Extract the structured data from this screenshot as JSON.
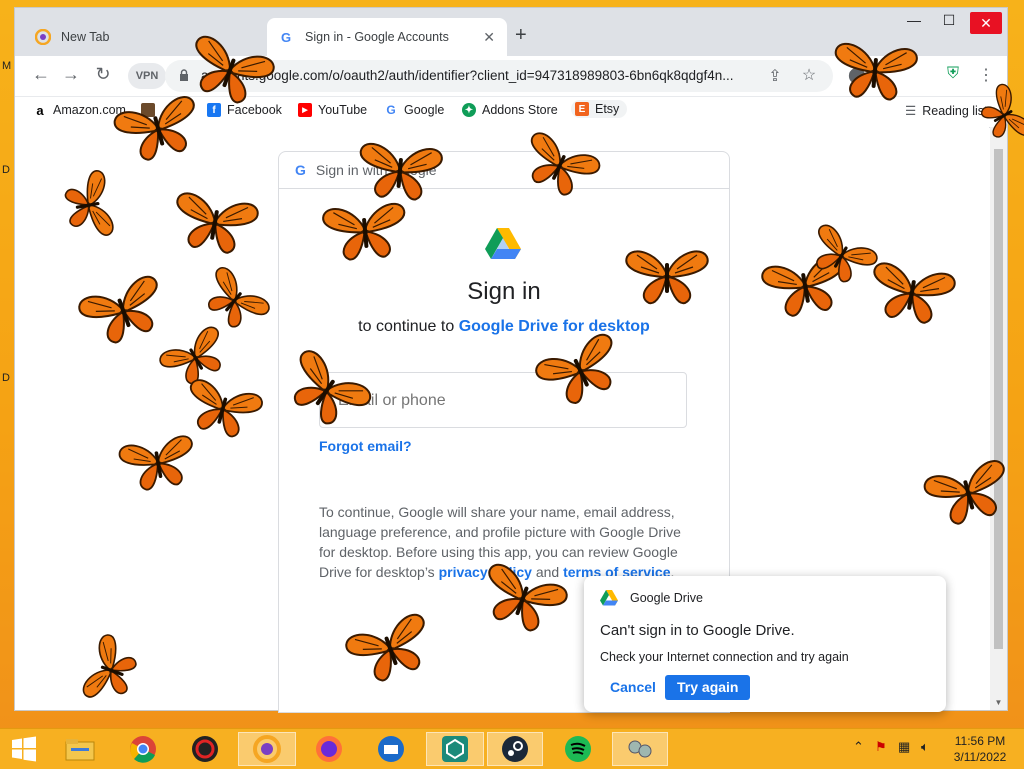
{
  "desktop": {
    "edge_letters": [
      "M",
      "D",
      "D"
    ]
  },
  "browser": {
    "tabs": [
      {
        "title": "New Tab",
        "active": false
      },
      {
        "title": "Sign in - Google Accounts",
        "active": true
      }
    ],
    "new_tab_symbol": "+",
    "window_controls": {
      "minimize": "—",
      "maximize": "☐",
      "close": "✕"
    },
    "vpn_label": "VPN",
    "url": "accounts.google.com/o/oauth2/auth/identifier?client_id=947318989803-6bn6qk8qdgf4n...",
    "reading_list": "Reading list",
    "bookmarks": [
      {
        "label": "Amazon.com",
        "icon": "amazon-icon",
        "color": "#000000"
      },
      {
        "label": "",
        "icon": "bookmark-icon",
        "color": "#6b4a2b"
      },
      {
        "label": "Facebook",
        "icon": "facebook-icon",
        "color": "#1877f2"
      },
      {
        "label": "YouTube",
        "icon": "youtube-icon",
        "color": "#ff0000"
      },
      {
        "label": "Google",
        "icon": "google-icon",
        "color": "#4285f4"
      },
      {
        "label": "Addons Store",
        "icon": "addons-store-icon",
        "color": "#0f9d58"
      },
      {
        "label": "Etsy",
        "icon": "etsy-icon",
        "color": "#f1641e"
      }
    ]
  },
  "signin": {
    "header": "Sign in with Google",
    "title": "Sign in",
    "subtitle_prefix": "to continue to ",
    "app_name": "Google Drive for desktop",
    "email_placeholder": "Email or phone",
    "forgot_email": "Forgot email?",
    "policy_text": "To continue, Google will share your name, email address, language preference, and profile picture with Google Drive for desktop. Before using this app, you can review Google Drive for desktop’s ",
    "privacy_policy": "privacy policy",
    "and": " and ",
    "terms": "terms of service",
    "period": "."
  },
  "notification": {
    "app": "Google Drive",
    "title": "Can't sign in to Google Drive.",
    "message": "Check your Internet connection and try again",
    "cancel": "Cancel",
    "retry": "Try again"
  },
  "taskbar": {
    "apps": [
      "windows-start",
      "file-explorer",
      "chrome",
      "red-app",
      "vpn-browser",
      "firefox",
      "thunderbird",
      "teal-app",
      "steam",
      "spotify",
      "network-app"
    ],
    "time": "11:56 PM",
    "date": "3/11/2022"
  },
  "colors": {
    "accent": "#1a73e8",
    "desktop": "#f5a214",
    "taskbar": "#f7b021"
  }
}
